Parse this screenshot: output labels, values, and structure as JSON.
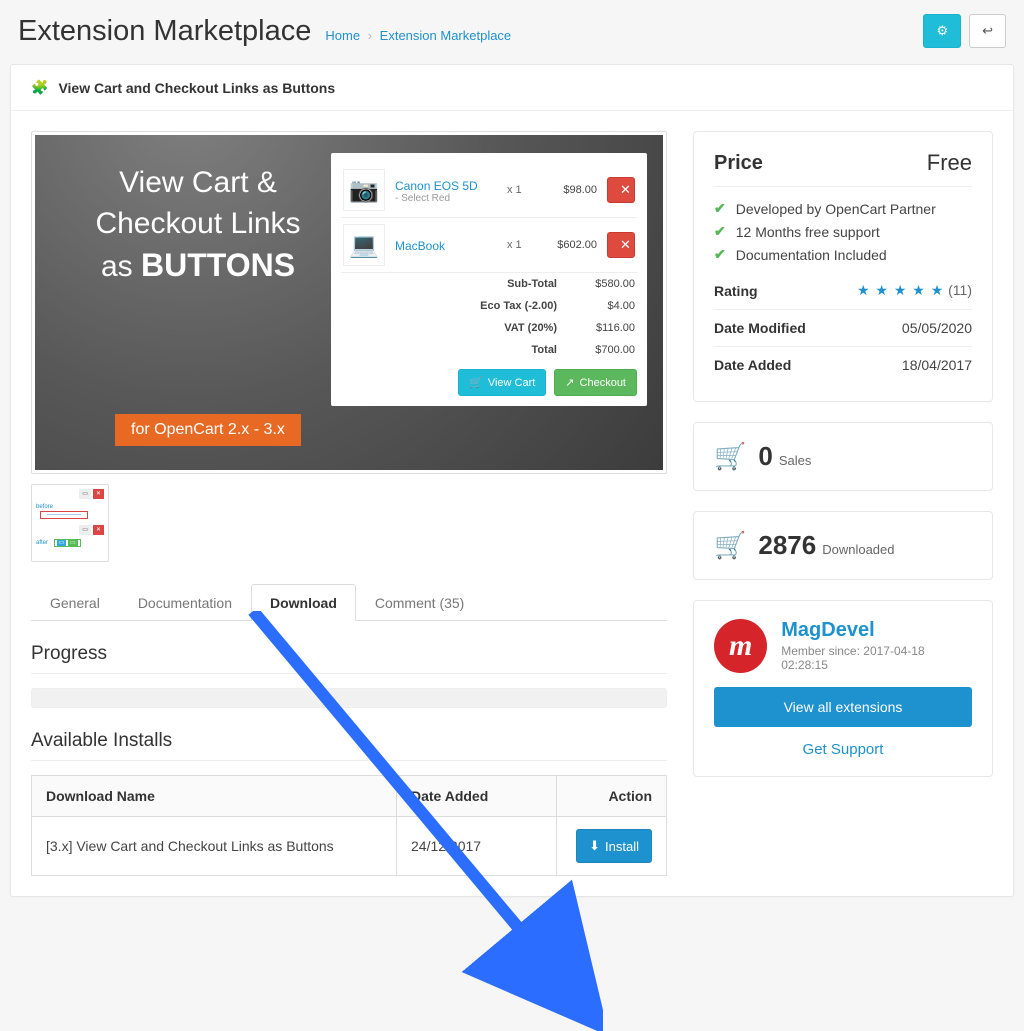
{
  "header": {
    "title": "Extension Marketplace",
    "home": "Home",
    "crumb": "Extension Marketplace"
  },
  "panel_title": "View Cart and Checkout Links as Buttons",
  "promo": {
    "heading_l1": "View Cart &",
    "heading_l2": "Checkout Links",
    "heading_l3a": "as ",
    "heading_l3b": "BUTTONS",
    "tag": "for OpenCart 2.x - 3.x",
    "items": [
      {
        "name": "Canon EOS 5D",
        "opt": "- Select Red",
        "qty": "x 1",
        "price": "$98.00"
      },
      {
        "name": "MacBook",
        "opt": "",
        "qty": "x 1",
        "price": "$602.00"
      }
    ],
    "totals": [
      {
        "lbl": "Sub-Total",
        "val": "$580.00"
      },
      {
        "lbl": "Eco Tax (-2.00)",
        "val": "$4.00"
      },
      {
        "lbl": "VAT (20%)",
        "val": "$116.00"
      },
      {
        "lbl": "Total",
        "val": "$700.00"
      }
    ],
    "view_cart": "View Cart",
    "checkout": "Checkout"
  },
  "tabs": {
    "general": "General",
    "docs": "Documentation",
    "download": "Download",
    "comment": "Comment (35)"
  },
  "progress_title": "Progress",
  "available_title": "Available Installs",
  "table": {
    "col_name": "Download Name",
    "col_date": "Date Added",
    "col_action": "Action",
    "rows": [
      {
        "name": "[3.x] View Cart and Checkout Links as Buttons",
        "date": "24/12/2017",
        "install": "Install"
      }
    ]
  },
  "side": {
    "price_lbl": "Price",
    "price_val": "Free",
    "features": [
      "Developed by OpenCart Partner",
      "12 Months free support",
      "Documentation Included"
    ],
    "rating_lbl": "Rating",
    "rating_count": "(11)",
    "date_mod_lbl": "Date Modified",
    "date_mod_val": "05/05/2020",
    "date_add_lbl": "Date Added",
    "date_add_val": "18/04/2017",
    "sales_num": "0",
    "sales_lbl": "Sales",
    "down_num": "2876",
    "down_lbl": "Downloaded",
    "dev_name": "MagDevel",
    "dev_since": "Member since: 2017-04-18 02:28:15",
    "view_all": "View all extensions",
    "support": "Get Support"
  }
}
